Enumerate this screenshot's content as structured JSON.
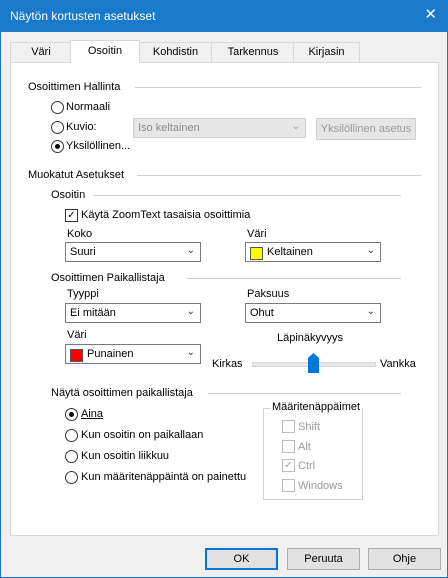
{
  "window": {
    "title": "Näytön kortusten asetukset",
    "close_glyph": "✕"
  },
  "tabs": [
    {
      "label": "Väri"
    },
    {
      "label": "Osoitin",
      "active": true
    },
    {
      "label": "Kohdistin"
    },
    {
      "label": "Tarkennus"
    },
    {
      "label": "Kirjasin"
    }
  ],
  "pointer_control": {
    "heading": "Osoittimen Hallinta",
    "normal": "Normaali",
    "scheme": "Kuvio:",
    "custom": "Yksilöllinen...",
    "selected": "custom",
    "scheme_value": "Iso keltainen",
    "custom_settings_button": "Yksilöllinen asetus"
  },
  "custom_settings": {
    "heading": "Muokatut Asetukset",
    "pointer": {
      "heading": "Osoitin",
      "use_zoomtext": "Käytä ZoomText tasaisia osoittimia",
      "use_zoomtext_checked": true,
      "size_label": "Koko",
      "size_value": "Suuri",
      "color_label": "Väri",
      "color_value": "Keltainen",
      "color_hex": "#ffff00"
    },
    "locator": {
      "heading": "Osoittimen Paikallistaja",
      "type_label": "Tyyppi",
      "type_value": "Ei mitään",
      "thickness_label": "Paksuus",
      "thickness_value": "Ohut",
      "color_label": "Väri",
      "color_value": "Punainen",
      "color_hex": "#ff0000",
      "transparency_label": "Läpinäkyvyys",
      "transparency_min": "Kirkas",
      "transparency_max": "Vankka",
      "transparency_level": 0.5
    }
  },
  "show_locator": {
    "heading": "Näytä osoittimen paikallistaja",
    "options": [
      "Aina",
      "Kun osoitin on paikallaan",
      "Kun osoitin liikkuu",
      "Kun määritenäppäintä on painettu"
    ],
    "selected_index": 0,
    "modifier_keys": {
      "heading": "Määritenäppäimet",
      "keys": [
        {
          "label": "Shift",
          "checked": false
        },
        {
          "label": "Alt",
          "checked": false
        },
        {
          "label": "Ctrl",
          "checked": true
        },
        {
          "label": "Windows",
          "checked": false
        }
      ]
    }
  },
  "buttons": {
    "ok": "OK",
    "cancel": "Peruuta",
    "help": "Ohje"
  },
  "colors": {
    "accent": "#0078d7",
    "titlebar": "#1979ca"
  },
  "icons": {
    "check": "✓",
    "dropdown_arrow": "⌄"
  }
}
